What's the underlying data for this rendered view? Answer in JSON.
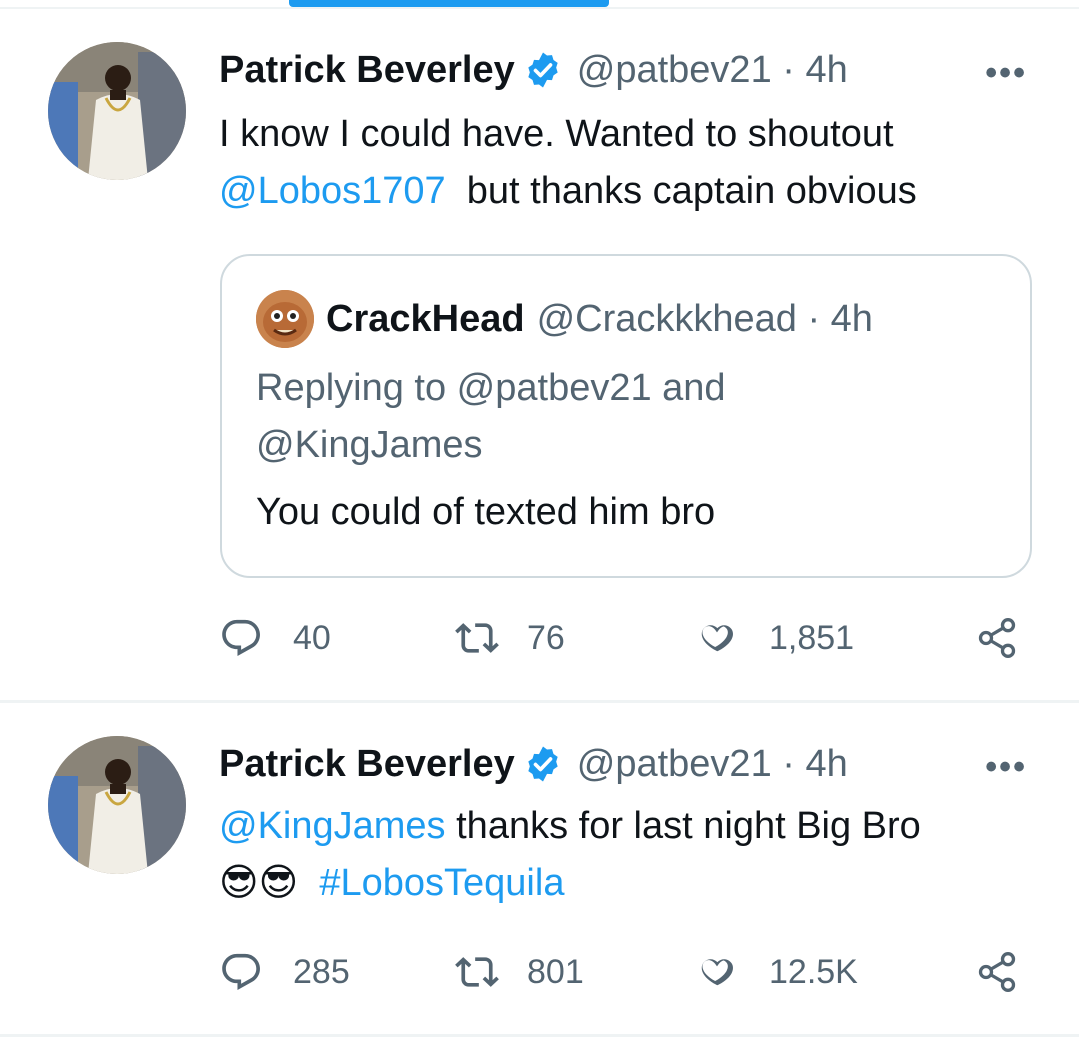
{
  "tweets": [
    {
      "author": {
        "name": "Patrick Beverley",
        "handle": "@patbev21",
        "time": "· 4h",
        "verified": true
      },
      "more_label": "•••",
      "text_line1": "I know I could have. Wanted to shoutout",
      "mention": "@Lobos1707",
      "text_line2_rest": "but thanks captain obvious",
      "quote": {
        "author": {
          "name": "CrackHead",
          "handle": "@Crackkkhead · 4h"
        },
        "reply_prefix": "Replying to ",
        "reply_mention1": "@patbev21",
        "reply_and": " and",
        "reply_mention2": "@KingJames",
        "text": "You could of texted him bro"
      },
      "stats": {
        "replies": "40",
        "retweets": "76",
        "likes": "1,851"
      }
    },
    {
      "author": {
        "name": "Patrick Beverley",
        "handle": "@patbev21",
        "time": "· 4h",
        "verified": true
      },
      "more_label": "•••",
      "mention": "@KingJames",
      "text_line1_rest": "thanks for last night Big Bro",
      "emoji": "😎😎",
      "hashtag": "#LobosTequila",
      "stats": {
        "replies": "285",
        "retweets": "801",
        "likes": "12.5K"
      }
    }
  ],
  "colors": {
    "accent": "#1d9bf0",
    "secondary_text": "#536471",
    "border": "#cfd9de"
  },
  "icons": [
    "verified-badge-icon",
    "more-icon",
    "reply-icon",
    "retweet-icon",
    "like-icon",
    "share-icon"
  ]
}
